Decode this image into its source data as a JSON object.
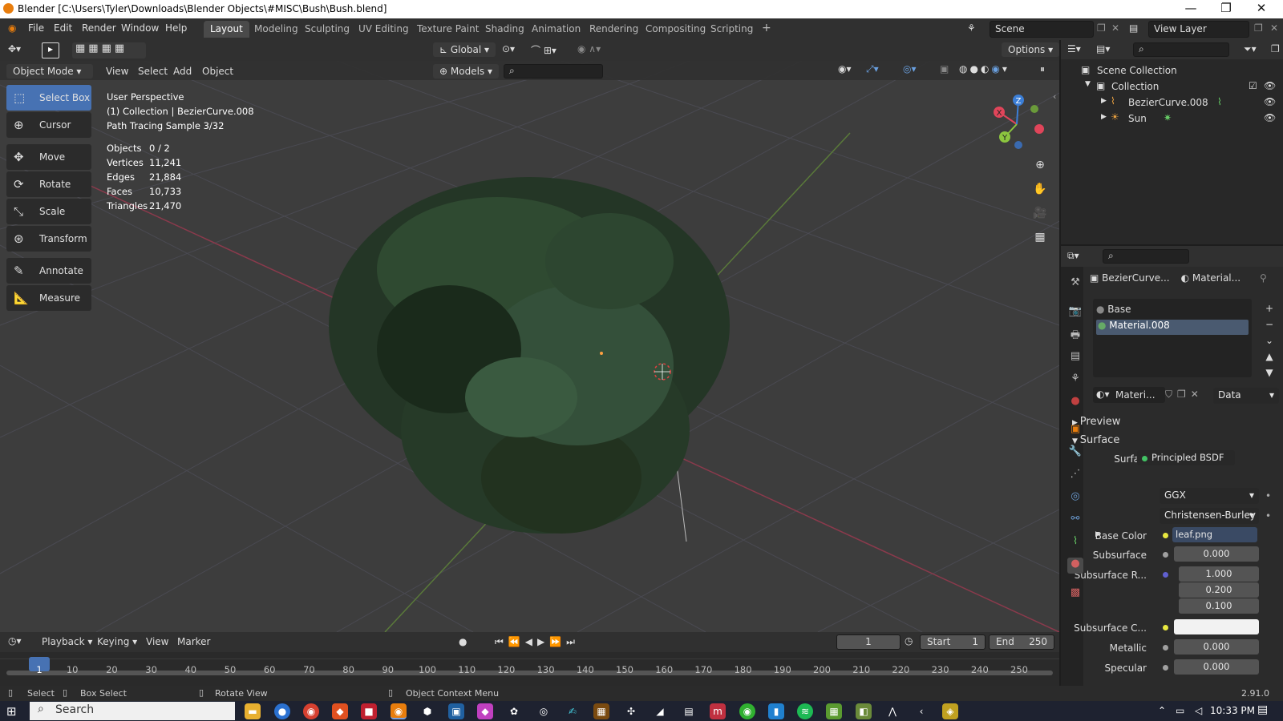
{
  "window": {
    "title": "Blender [C:\\Users\\Tyler\\Downloads\\Blender Objects\\#MISC\\Bush\\Bush.blend]",
    "controls": [
      "—",
      "❐",
      "✕"
    ]
  },
  "menu": [
    "File",
    "Edit",
    "Render",
    "Window",
    "Help"
  ],
  "workspaces": [
    "Layout",
    "Modeling",
    "Sculpting",
    "UV Editing",
    "Texture Paint",
    "Shading",
    "Animation",
    "Rendering",
    "Compositing",
    "Scripting"
  ],
  "active_workspace": "Layout",
  "scene": {
    "label": "Scene",
    "view_layer": "View Layer"
  },
  "header_tools": {
    "orientation": "Global",
    "options": "Options"
  },
  "viewport_header": {
    "mode": "Object Mode",
    "menus": [
      "View",
      "Select",
      "Add",
      "Object"
    ],
    "collection_filter": "Models"
  },
  "toolbar": {
    "tools": [
      {
        "label": "Select Box",
        "icon": "select-box-icon",
        "active": true
      },
      {
        "label": "Cursor",
        "icon": "cursor-icon",
        "active": false
      },
      {
        "label": "Move",
        "icon": "move-icon",
        "active": false
      },
      {
        "label": "Rotate",
        "icon": "rotate-icon",
        "active": false
      },
      {
        "label": "Scale",
        "icon": "scale-icon",
        "active": false
      },
      {
        "label": "Transform",
        "icon": "transform-icon",
        "active": false
      },
      {
        "label": "Annotate",
        "icon": "annotate-icon",
        "active": false
      },
      {
        "label": "Measure",
        "icon": "measure-icon",
        "active": false
      }
    ]
  },
  "overlay": {
    "view": "User Perspective",
    "collection": "(1) Collection | BezierCurve.008",
    "render": "Path Tracing Sample 3/32",
    "stats": [
      {
        "label": "Objects",
        "value": "0 / 2"
      },
      {
        "label": "Vertices",
        "value": "11,241"
      },
      {
        "label": "Edges",
        "value": "21,884"
      },
      {
        "label": "Faces",
        "value": "10,733"
      },
      {
        "label": "Triangles",
        "value": "21,470"
      }
    ]
  },
  "gizmo": {
    "x": "X",
    "y": "Y",
    "z": "Z"
  },
  "timeline": {
    "menus": [
      "Playback",
      "Keying",
      "View",
      "Marker"
    ],
    "current_frame": "1",
    "start_label": "Start",
    "start": "1",
    "end_label": "End",
    "end": "250",
    "ticks": [
      "1",
      "10",
      "20",
      "30",
      "40",
      "50",
      "60",
      "70",
      "80",
      "90",
      "100",
      "110",
      "120",
      "130",
      "140",
      "150",
      "160",
      "170",
      "180",
      "190",
      "200",
      "210",
      "220",
      "230",
      "240",
      "250"
    ]
  },
  "statusbar": {
    "select": "Select",
    "box_select": "Box Select",
    "rotate_view": "Rotate View",
    "context_menu": "Object Context Menu",
    "version": "2.91.0"
  },
  "outliner": {
    "root": "Scene Collection",
    "collection": "Collection",
    "items": [
      {
        "name": "BezierCurve.008",
        "icon": "curve-icon"
      },
      {
        "name": "Sun",
        "icon": "light-icon"
      }
    ]
  },
  "properties": {
    "object_name": "BezierCurve...",
    "material_tab": "Material...",
    "slots": [
      "Base",
      "Material.008"
    ],
    "selected_slot": "Material.008",
    "material_field": "Materi...",
    "link": "Data",
    "panels": {
      "preview": "Preview",
      "surface": "Surface"
    },
    "surface_label": "Surface",
    "surface_shader": "Principled BSDF",
    "distribution": "GGX",
    "subsurface_method": "Christensen-Burley",
    "rows": [
      {
        "label": "Base Color",
        "value": "leaf.png"
      },
      {
        "label": "Subsurface",
        "value": "0.000"
      },
      {
        "label": "Subsurface R...",
        "value": "1.000"
      },
      {
        "label": "",
        "value": "0.200"
      },
      {
        "label": "",
        "value": "0.100"
      },
      {
        "label": "Subsurface C...",
        "value": ""
      },
      {
        "label": "Metallic",
        "value": "0.000"
      },
      {
        "label": "Specular",
        "value": "0.000"
      }
    ]
  },
  "taskbar": {
    "search": "Search",
    "time": "10:33 PM"
  },
  "colors": {
    "accent": "#4772b3",
    "axis_x": "#e0455a",
    "axis_y": "#8cc63f",
    "axis_z": "#3b7ed6",
    "blender_orange": "#e87d0d"
  }
}
